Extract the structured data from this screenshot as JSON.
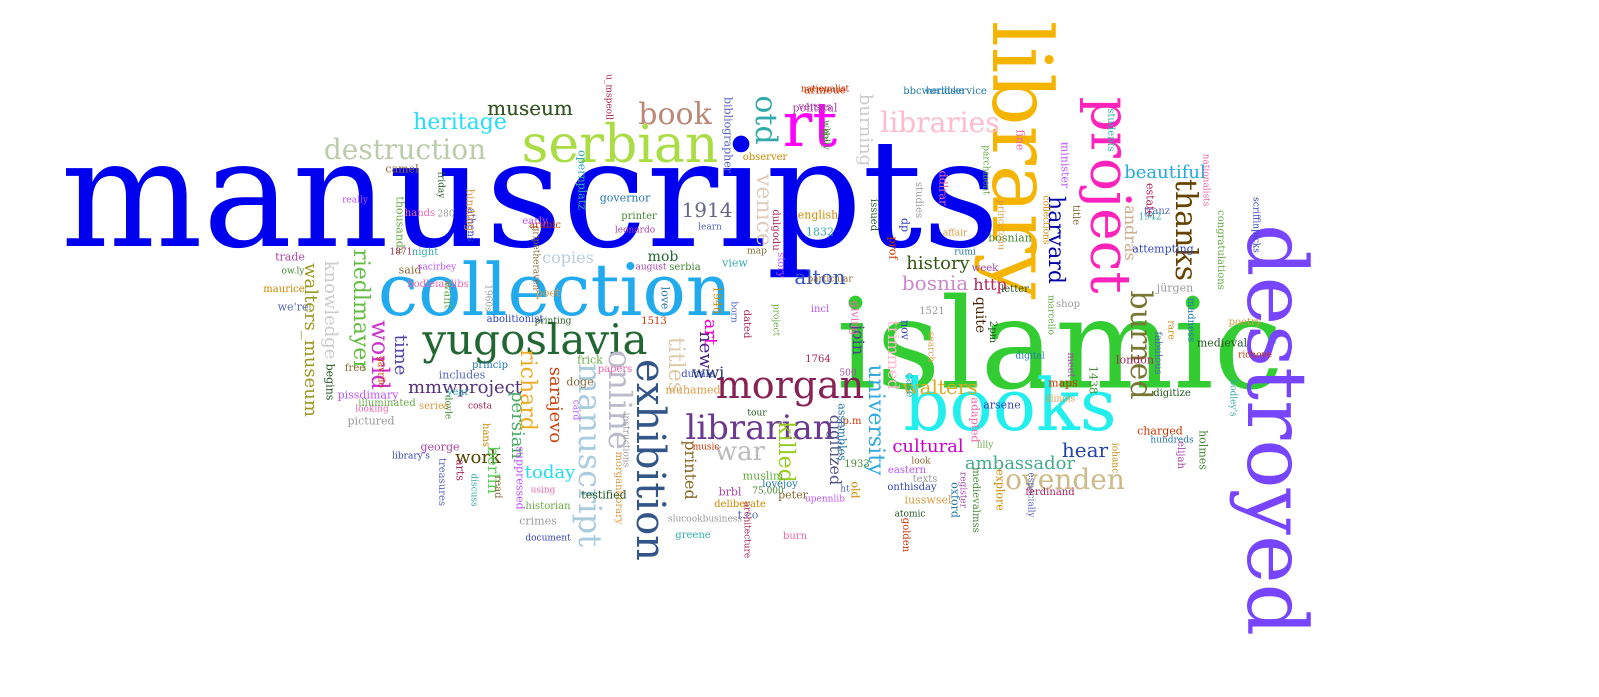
{
  "cloud": {
    "words": [
      {
        "text": "manuscripts",
        "color": "#0000ee"
      },
      {
        "text": "islamic",
        "color": "#33cc33"
      },
      {
        "text": "library",
        "color": "#f5b400"
      },
      {
        "text": "destroyed",
        "color": "#7744ff"
      },
      {
        "text": "collection",
        "color": "#22aaee"
      },
      {
        "text": "books",
        "color": "#22eeee"
      },
      {
        "text": "project",
        "color": "#ff22bb"
      },
      {
        "text": "serbian",
        "color": "#aadd44"
      },
      {
        "text": "rt",
        "color": "#ff00ff"
      },
      {
        "text": "yugoslavia",
        "color": "#226633"
      },
      {
        "text": "exhibition",
        "color": "#335588"
      },
      {
        "text": "morgan",
        "color": "#882255"
      },
      {
        "text": "librarian",
        "color": "#6a3a90"
      },
      {
        "text": "manuscript",
        "color": "#aaccdd"
      },
      {
        "text": "online",
        "color": "#bbbbcc"
      },
      {
        "text": "burned",
        "color": "#777733"
      },
      {
        "text": "thanks",
        "color": "#664400"
      },
      {
        "text": "ovenden",
        "color": "#ccbb88"
      },
      {
        "text": "destruction",
        "color": "#bbccaa"
      },
      {
        "text": "book",
        "color": "#bb8877"
      },
      {
        "text": "otd",
        "color": "#33aaaa"
      },
      {
        "text": "libraries",
        "color": "#ffbbcc"
      },
      {
        "text": "war",
        "color": "#bbbbbb"
      },
      {
        "text": "riedlmayer",
        "color": "#66bb44"
      },
      {
        "text": "knowledge",
        "color": "#cccccc"
      },
      {
        "text": "walters_museum",
        "color": "#999922"
      },
      {
        "text": "world",
        "color": "#cc33cc"
      },
      {
        "text": "heritage",
        "color": "#22ddff"
      },
      {
        "text": "museum",
        "color": "#335522"
      },
      {
        "text": "harvard",
        "color": "#0000aa"
      },
      {
        "text": "university",
        "color": "#33aadd"
      },
      {
        "text": "killed",
        "color": "#99cc22"
      },
      {
        "text": "titles",
        "color": "#ddccaa"
      },
      {
        "text": "venice",
        "color": "#ddccbb"
      },
      {
        "text": "burning",
        "color": "#cccccc"
      },
      {
        "text": "1914",
        "color": "#666688"
      },
      {
        "text": "alton",
        "color": "#3355cc"
      },
      {
        "text": "bosnia",
        "color": "#cc88cc"
      },
      {
        "text": "history",
        "color": "#335511"
      },
      {
        "text": "walters",
        "color": "#ddaa22"
      },
      {
        "text": "cultural",
        "color": "#cc00cc"
      },
      {
        "text": "ambassador",
        "color": "#44aa88"
      },
      {
        "text": "hear",
        "color": "#2244aa"
      },
      {
        "text": "beautiful",
        "color": "#22aadd"
      },
      {
        "text": "andrás",
        "color": "#ccaa88"
      },
      {
        "text": "richard",
        "color": "#eeaa22"
      },
      {
        "text": "sarajevo",
        "color": "#cc4411"
      },
      {
        "text": "persian",
        "color": "#44aa66"
      },
      {
        "text": "today",
        "color": "#22ddee"
      },
      {
        "text": "work",
        "color": "#554400"
      },
      {
        "text": "berlin",
        "color": "#55cc55"
      },
      {
        "text": "mmwproject",
        "color": "#553377"
      },
      {
        "text": "time",
        "color": "#5544aa"
      },
      {
        "text": "new",
        "color": "#442288"
      },
      {
        "text": "art",
        "color": "#ff00cc"
      },
      {
        "text": "wwi",
        "color": "#223366"
      },
      {
        "text": "copies",
        "color": "#bbccdd"
      },
      {
        "text": "printed",
        "color": "#886622"
      },
      {
        "text": "digitized",
        "color": "#555588"
      },
      {
        "text": "join",
        "color": "#444488"
      },
      {
        "text": "trimmed",
        "color": "#ffbbcc"
      },
      {
        "text": "http",
        "color": "#bb2255"
      },
      {
        "text": "quite",
        "color": "#442200"
      },
      {
        "text": "mob",
        "color": "#226633"
      },
      {
        "text": "museum",
        "color": "#335522"
      }
    ],
    "small_words": [
      "nationalist",
      "bbcworldservice",
      "political",
      "wholly",
      "observer",
      "bibliographer",
      "u_mspeoll",
      "students",
      "camel",
      "really",
      "hands",
      "thousands",
      "280",
      "athens",
      "binding",
      "friday",
      "arabic",
      "governor",
      "leonardo",
      "printer",
      "english",
      "learn",
      "dulgodu",
      "1832",
      "map",
      "story",
      "fine",
      "parchment",
      "studies",
      "dp",
      "affair",
      "issued",
      "prof",
      "rumi",
      "week",
      "bosnian",
      "collections",
      "franz",
      "estate",
      "1942",
      "title",
      "minister",
      "nationalists",
      "congratulations",
      "jürgen",
      "scriffinpicks",
      "poetry",
      "medieval",
      "richove",
      "madness",
      "trade",
      "ow.ly",
      "maurice",
      "we're",
      "1871",
      "night",
      "said",
      "sacirbey",
      "bodleianlibs",
      "want",
      "1960s",
      "abolitionist",
      "poet",
      "printing",
      "1513",
      "love",
      "august",
      "serbia",
      "1946",
      "born",
      "dated",
      "view",
      "particular",
      "incl",
      "giving",
      "project",
      "1521",
      "nov",
      "search",
      "2pm",
      "maps",
      "digital",
      "meet",
      "1438",
      "rare",
      "fabulous",
      "london",
      "bodley's",
      "free",
      "pissdimary",
      "looking",
      "illuminated",
      "pictured",
      "library's",
      "series",
      "begins",
      "gavrilo",
      "princip",
      "george",
      "doyle",
      "hans",
      "includes",
      "costa",
      "year",
      "doge",
      "card",
      "papers",
      "frick",
      "instructions",
      "ducale",
      "muhamed",
      "tour",
      "p.m",
      "assembles",
      "500",
      "1933",
      "old",
      "ht",
      "1764",
      "case",
      "look",
      "eastern",
      "adapted",
      "lilly",
      "texts",
      "arsene",
      "illinois",
      "digitize",
      "charged",
      "hundreds",
      "elijah",
      "holmes",
      "iohanc",
      "treasures",
      "arts",
      "discuss",
      "read",
      "suppressed",
      "using",
      "historian",
      "crimes",
      "document",
      "morganlibrary",
      "testified",
      "music",
      "lovejoy",
      "brbl",
      "75,000",
      "deliberate",
      "t.co",
      "architecture",
      "greene",
      "peter",
      "upennlib",
      "burn",
      "muslim",
      "slucookbusiness",
      "onthisday",
      "iusswsel",
      "atomic",
      "golden",
      "oxford",
      "register",
      "medievalmss",
      "explore",
      "especially",
      "ferdinand",
      "opernplatz",
      "gripetheraven",
      "early",
      "ddlrar",
      "marcello",
      "shop",
      "attempting",
      "princetonu",
      "letter",
      "armeue",
      "herduke",
      "versus",
      "dr"
    ]
  }
}
